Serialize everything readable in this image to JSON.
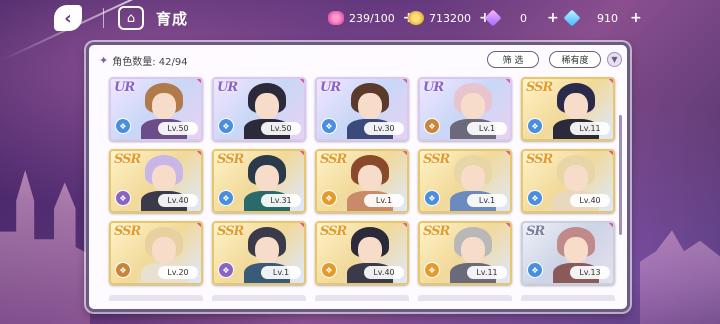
{
  "header": {
    "back_icon": "back-arrow-icon",
    "home_icon": "castle-icon",
    "title": "育成"
  },
  "resources": [
    {
      "name": "candy",
      "icon": "candy-icon",
      "value": "239/100",
      "plus": "+",
      "color": "#e45ca8"
    },
    {
      "name": "coin",
      "icon": "coin-icon",
      "value": "713200",
      "plus": "+",
      "color": "#e0a52a"
    },
    {
      "name": "gem_pink",
      "icon": "gem-pink-icon",
      "value": "0",
      "plus": "+",
      "color": "#b07bff"
    },
    {
      "name": "gem_blue",
      "icon": "gem-blue-icon",
      "value": "910",
      "plus": "+",
      "color": "#42b6ff"
    }
  ],
  "panel": {
    "count_label": "角色数量: 42/94",
    "filter_label": "筛 选",
    "rarity_label": "稀有度",
    "sort_icon": "chevron-down-icon"
  },
  "cards": [
    {
      "rarity": "UR",
      "level": "Lv.50",
      "attr_color": "#4a8ee0",
      "hair": "#b07a4a",
      "outfit": "#6b4d8a"
    },
    {
      "rarity": "UR",
      "level": "Lv.50",
      "attr_color": "#4a8ee0",
      "hair": "#2a2a3a",
      "outfit": "#2a2a3a"
    },
    {
      "rarity": "UR",
      "level": "Lv.30",
      "attr_color": "#4a8ee0",
      "hair": "#5a3a2a",
      "outfit": "#3a4a7a"
    },
    {
      "rarity": "UR",
      "level": "Lv.1",
      "attr_color": "#c9853a",
      "hair": "#e8c4cf",
      "outfit": "#6a6a7a"
    },
    {
      "rarity": "SSR",
      "level": "Lv.11",
      "attr_color": "#4a8ee0",
      "hair": "#2a2a4a",
      "outfit": "#2a2a3a"
    },
    {
      "rarity": "SSR",
      "level": "Lv.40",
      "attr_color": "#8a63c6",
      "hair": "#c9b6e8",
      "outfit": "#3a3a4a"
    },
    {
      "rarity": "SSR",
      "level": "Lv.31",
      "attr_color": "#4a8ee0",
      "hair": "#2a3a4a",
      "outfit": "#2a6a6a"
    },
    {
      "rarity": "SSR",
      "level": "Lv.1",
      "attr_color": "#e39b2b",
      "hair": "#8a4a2a",
      "outfit": "#c98a6a"
    },
    {
      "rarity": "SSR",
      "level": "Lv.1",
      "attr_color": "#4a8ee0",
      "hair": "#e8d6a6",
      "outfit": "#6a8ac0"
    },
    {
      "rarity": "SSR",
      "level": "Lv.40",
      "attr_color": "#4a8ee0",
      "hair": "#e8d6a6",
      "outfit": "#e8d8c0"
    },
    {
      "rarity": "SSR",
      "level": "Lv.20",
      "attr_color": "#c9853a",
      "hair": "#e8d0a0",
      "outfit": "#e8e0d0"
    },
    {
      "rarity": "SSR",
      "level": "Lv.1",
      "attr_color": "#8a63c6",
      "hair": "#3a3a4a",
      "outfit": "#3a5a7a"
    },
    {
      "rarity": "SSR",
      "level": "Lv.40",
      "attr_color": "#e39b2b",
      "hair": "#2a2a3a",
      "outfit": "#3a3a4a"
    },
    {
      "rarity": "SSR",
      "level": "Lv.11",
      "attr_color": "#e39b2b",
      "hair": "#b8b8b8",
      "outfit": "#6a6a7a"
    },
    {
      "rarity": "SR",
      "level": "Lv.13",
      "attr_color": "#4a8ee0",
      "hair": "#c08a8a",
      "outfit": "#8a5a5a"
    }
  ]
}
